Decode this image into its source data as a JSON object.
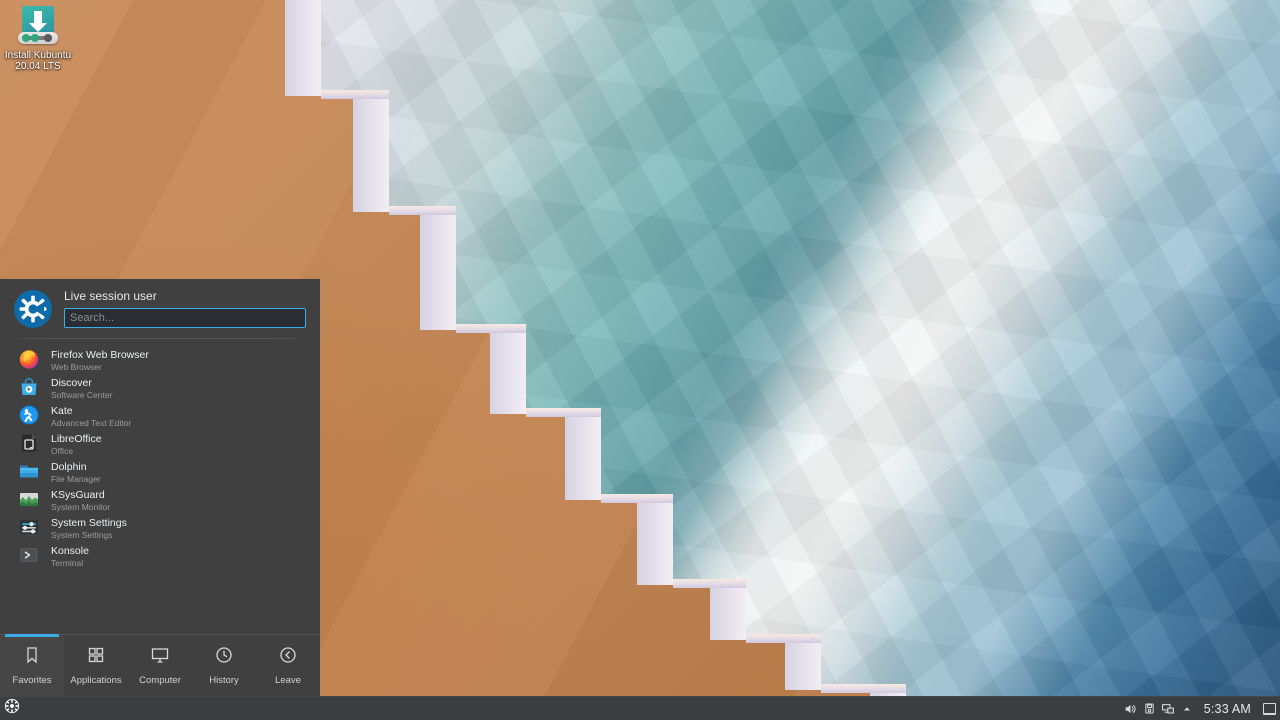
{
  "desktop": {
    "icon": {
      "name": "install-kubuntu",
      "label_line1": "Install Kubuntu",
      "label_line2": "20.04 LTS",
      "icon_name": "install-disc-icon"
    },
    "wallpaper_name": "kubuntu-focal-fossa-wallpaper"
  },
  "kickoff": {
    "user_name": "Live session user",
    "avatar_icon": "kubuntu-logo-icon",
    "search": {
      "placeholder": "Search...",
      "value": ""
    },
    "favorites": [
      {
        "name": "Firefox Web Browser",
        "description": "Web Browser",
        "icon": "firefox-icon"
      },
      {
        "name": "Discover",
        "description": "Software Center",
        "icon": "discover-bag-icon"
      },
      {
        "name": "Kate",
        "description": "Advanced Text Editor",
        "icon": "kate-icon"
      },
      {
        "name": "LibreOffice",
        "description": "Office",
        "icon": "libreoffice-document-icon"
      },
      {
        "name": "Dolphin",
        "description": "File Manager",
        "icon": "dolphin-folder-icon"
      },
      {
        "name": "KSysGuard",
        "description": "System Monitor",
        "icon": "ksysguard-chart-icon"
      },
      {
        "name": "System Settings",
        "description": "System Settings",
        "icon": "system-settings-sliders-icon"
      },
      {
        "name": "Konsole",
        "description": "Terminal",
        "icon": "konsole-prompt-icon"
      }
    ],
    "tabs": [
      {
        "label": "Favorites",
        "icon": "bookmark-icon",
        "active": true
      },
      {
        "label": "Applications",
        "icon": "grid-squares-icon",
        "active": false
      },
      {
        "label": "Computer",
        "icon": "monitor-icon",
        "active": false
      },
      {
        "label": "History",
        "icon": "clock-icon",
        "active": false
      },
      {
        "label": "Leave",
        "icon": "power-back-icon",
        "active": false
      }
    ]
  },
  "panel": {
    "launcher": {
      "label": "Application Launcher",
      "icon": "kubuntu-logo-icon"
    },
    "tray": [
      {
        "name": "volume",
        "icon": "speaker-icon"
      },
      {
        "name": "removable-devices",
        "icon": "usb-device-icon"
      },
      {
        "name": "network",
        "icon": "network-icon"
      },
      {
        "name": "show-hidden",
        "icon": "chevron-up-icon"
      }
    ],
    "clock": "5:33 AM",
    "show_desktop": {
      "label": "Show Desktop",
      "icon": "show-desktop-icon"
    }
  },
  "colors": {
    "accent": "#3daee9",
    "menu_bg": "#404040",
    "panel_bg": "#3b3e40",
    "sand": "#c58a58",
    "ocean_deep": "#2a5880"
  }
}
